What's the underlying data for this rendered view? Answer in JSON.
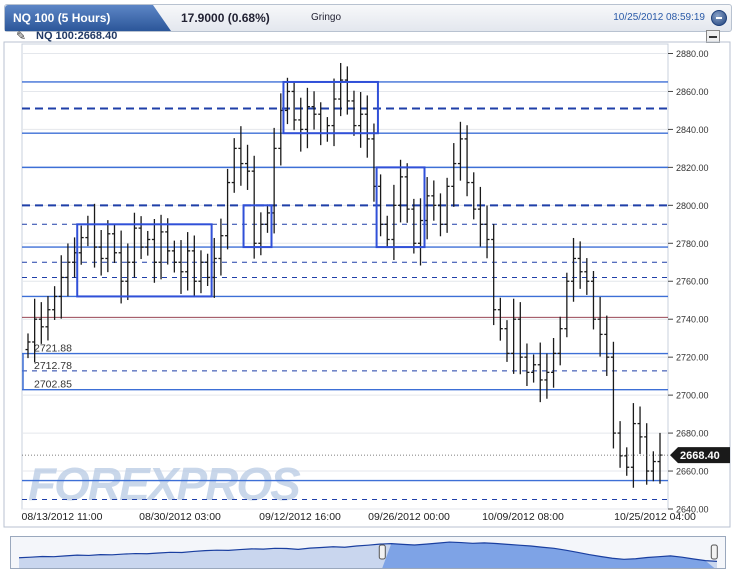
{
  "header": {
    "title": "NQ 100 (5 Hours)",
    "price_change": "17.9000 (0.68%)",
    "user": "Gringo",
    "datetime": "10/25/2012 08:59:19"
  },
  "chart_label": "NQ 100:2668.40",
  "last_price_label": "2668.40",
  "watermark": "FOREXPROS",
  "colors": {
    "candle": "#1a1a1a",
    "solid_line": "#3d6fd6",
    "dashed_line": "#1f3fa8",
    "box": "#3050d8",
    "header_blue": "#2b5699",
    "navigator_fill": "#7ea3e6"
  },
  "chart_data": {
    "type": "ohlc",
    "ylim": [
      2640,
      2885
    ],
    "y_ticks": [
      "2880.00",
      "2860.00",
      "2840.00",
      "2820.00",
      "2800.00",
      "2780.00",
      "2760.00",
      "2740.00",
      "2720.00",
      "2700.00",
      "2680.00",
      "2660.00",
      "2640.00"
    ],
    "x_ticks": [
      "08/13/2012 11:00",
      "08/30/2012 03:00",
      "09/12/2012 16:00",
      "09/26/2012 00:00",
      "10/09/2012 08:00",
      "10/25/2012 04:00"
    ],
    "last_price": 2668.4,
    "solid_levels": [
      2865,
      2838,
      2820,
      2778,
      2752,
      2721.88,
      2702.85,
      2655
    ],
    "dashed_levels": [
      2851,
      2800,
      2790,
      2770,
      2762,
      2712.78,
      2645
    ],
    "bold_dashed_levels": [
      2851,
      2800
    ],
    "annotated_levels": [
      {
        "label": "2721.88",
        "value": 2721.88
      },
      {
        "label": "2712.78",
        "value": 2712.78
      },
      {
        "label": "2702.85",
        "value": 2702.85
      }
    ],
    "boxes": [
      {
        "bar_from": 8,
        "bar_to": 27,
        "high": 2790,
        "low": 2752
      },
      {
        "bar_from": 33,
        "bar_to": 36,
        "high": 2800,
        "low": 2778
      },
      {
        "bar_from": 39,
        "bar_to": 52,
        "high": 2865,
        "low": 2838
      },
      {
        "bar_from": 53,
        "bar_to": 59,
        "high": 2820,
        "low": 2778
      }
    ],
    "closes": [
      2728,
      2740,
      2736,
      2745,
      2752,
      2762,
      2770,
      2775,
      2783,
      2790,
      2778,
      2772,
      2785,
      2775,
      2760,
      2770,
      2788,
      2778,
      2782,
      2770,
      2786,
      2776,
      2770,
      2765,
      2776,
      2760,
      2770,
      2762,
      2772,
      2784,
      2812,
      2830,
      2822,
      2818,
      2780,
      2790,
      2796,
      2830,
      2850,
      2860,
      2845,
      2840,
      2852,
      2848,
      2838,
      2842,
      2856,
      2866,
      2855,
      2842,
      2848,
      2835,
      2810,
      2790,
      2782,
      2800,
      2815,
      2798,
      2780,
      2792,
      2805,
      2800,
      2790,
      2810,
      2822,
      2835,
      2812,
      2798,
      2790,
      2782,
      2745,
      2735,
      2722,
      2740,
      2720,
      2712,
      2716,
      2708,
      2712,
      2722,
      2735,
      2760,
      2772,
      2765,
      2760,
      2740,
      2732,
      2720,
      2680,
      2668,
      2662,
      2685,
      2678,
      2660,
      2665,
      2668.4
    ]
  },
  "navigator": {
    "closes": [
      2700,
      2705,
      2712,
      2710,
      2718,
      2725,
      2722,
      2730,
      2728,
      2735,
      2740,
      2738,
      2745,
      2752,
      2750,
      2760,
      2768,
      2772,
      2770,
      2778,
      2785,
      2782,
      2790,
      2788,
      2780,
      2792,
      2798,
      2805,
      2800,
      2812,
      2820,
      2830,
      2835,
      2828,
      2822,
      2830,
      2840,
      2850,
      2845,
      2838,
      2842,
      2836,
      2828,
      2820,
      2812,
      2800,
      2790,
      2772,
      2752,
      2730,
      2712,
      2695,
      2685,
      2690,
      2702,
      2710,
      2718,
      2705,
      2688,
      2672,
      2665
    ],
    "window_from": 0.52,
    "window_to": 0.985
  }
}
